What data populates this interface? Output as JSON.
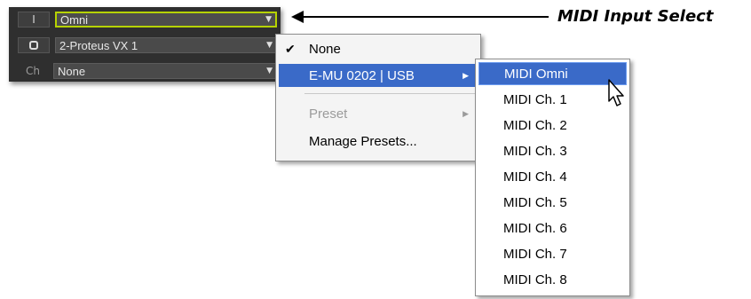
{
  "track_rows": [
    {
      "badge": "I",
      "value": "Omni"
    },
    {
      "badge": "",
      "value": "2-Proteus VX 1"
    },
    {
      "badge": "Ch",
      "value": "None"
    }
  ],
  "callout": {
    "label": "MIDI Input Select"
  },
  "primary_menu": {
    "items": [
      {
        "label": "None",
        "checked": true
      },
      {
        "label": "E-MU 0202 | USB",
        "highlighted": true,
        "has_submenu": true
      },
      {
        "label": "Preset",
        "disabled": true,
        "has_submenu": true
      },
      {
        "label": "Manage Presets..."
      }
    ]
  },
  "submenu": {
    "items": [
      "MIDI Omni",
      "MIDI Ch. 1",
      "MIDI Ch. 2",
      "MIDI Ch. 3",
      "MIDI Ch. 4",
      "MIDI Ch. 5",
      "MIDI Ch. 6",
      "MIDI Ch. 7",
      "MIDI Ch. 8"
    ],
    "highlighted_index": 0
  },
  "colors": {
    "panel_bg": "#2f2f2f",
    "selected_border": "#b6d200",
    "menu_highlight": "#3a6ac8"
  },
  "icons": {
    "check": "checkmark-icon",
    "submenu_arrow": "submenu-arrow-icon",
    "dropdown_arrow": "dropdown-arrow-icon",
    "cursor": "mouse-pointer-icon"
  }
}
